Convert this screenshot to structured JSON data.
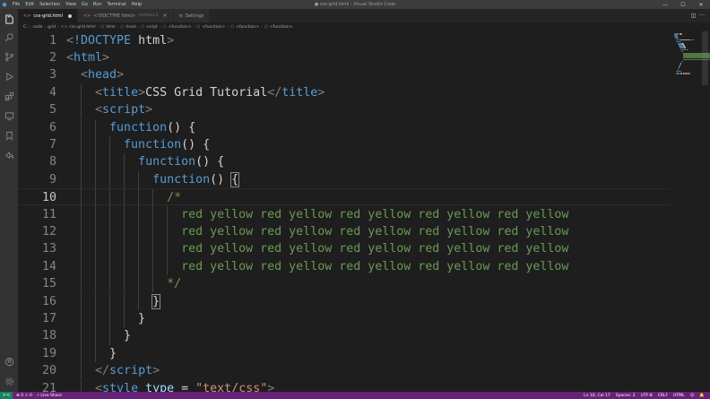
{
  "titlebar": {
    "menu": [
      "File",
      "Edit",
      "Selection",
      "View",
      "Go",
      "Run",
      "Terminal",
      "Help"
    ],
    "title": "● css-grid.html - Visual Studio Code"
  },
  "tabs": [
    {
      "label": "css-grid.html",
      "modified": true,
      "active": true
    },
    {
      "label": "<!DOCTYPE html>",
      "sub": "Untitled-1",
      "active": false
    },
    {
      "label": "Settings",
      "active": false
    }
  ],
  "breadcrumb": [
    "code",
    "grid",
    "css-grid.html",
    "html",
    "head",
    "script",
    "<function>",
    "<function>",
    "<function>",
    "<function>"
  ],
  "editor": {
    "current_line": 10,
    "lines": [
      {
        "n": "1",
        "tokens": [
          [
            "punc",
            "<"
          ],
          [
            "tag",
            "!DOCTYPE"
          ],
          [
            "text",
            " html"
          ],
          [
            "punc",
            ">"
          ]
        ]
      },
      {
        "n": "2",
        "tokens": [
          [
            "punc",
            "<"
          ],
          [
            "tag",
            "html"
          ],
          [
            "punc",
            ">"
          ]
        ]
      },
      {
        "n": "3",
        "tokens": [
          [
            "plain",
            "  "
          ],
          [
            "punc",
            "<"
          ],
          [
            "tag",
            "head"
          ],
          [
            "punc",
            ">"
          ]
        ]
      },
      {
        "n": "4",
        "tokens": [
          [
            "plain",
            "    "
          ],
          [
            "punc",
            "<"
          ],
          [
            "tag",
            "title"
          ],
          [
            "punc",
            ">"
          ],
          [
            "text",
            "CSS Grid Tutorial"
          ],
          [
            "punc",
            "</"
          ],
          [
            "tag",
            "title"
          ],
          [
            "punc",
            ">"
          ]
        ]
      },
      {
        "n": "5",
        "tokens": [
          [
            "plain",
            "    "
          ],
          [
            "punc",
            "<"
          ],
          [
            "tag",
            "script"
          ],
          [
            "punc",
            ">"
          ]
        ]
      },
      {
        "n": "6",
        "tokens": [
          [
            "plain",
            "      "
          ],
          [
            "kw",
            "function"
          ],
          [
            "plain",
            "() {"
          ]
        ]
      },
      {
        "n": "7",
        "tokens": [
          [
            "plain",
            "        "
          ],
          [
            "kw",
            "function"
          ],
          [
            "plain",
            "() {"
          ]
        ]
      },
      {
        "n": "8",
        "tokens": [
          [
            "plain",
            "          "
          ],
          [
            "kw",
            "function"
          ],
          [
            "plain",
            "() {"
          ]
        ]
      },
      {
        "n": "9",
        "tokens": [
          [
            "plain",
            "            "
          ],
          [
            "kw",
            "function"
          ],
          [
            "plain",
            "() "
          ],
          [
            "box",
            "{"
          ]
        ]
      },
      {
        "n": "10",
        "tokens": [
          [
            "plain",
            "              "
          ],
          [
            "cm",
            "/*"
          ]
        ]
      },
      {
        "n": "11",
        "tokens": [
          [
            "plain",
            "                "
          ],
          [
            "cm",
            "red yellow red yellow red yellow red yellow red yellow"
          ]
        ]
      },
      {
        "n": "12",
        "tokens": [
          [
            "plain",
            "                "
          ],
          [
            "cm",
            "red yellow red yellow red yellow red yellow red yellow"
          ]
        ]
      },
      {
        "n": "13",
        "tokens": [
          [
            "plain",
            "                "
          ],
          [
            "cm",
            "red yellow red yellow red yellow red yellow red yellow"
          ]
        ]
      },
      {
        "n": "14",
        "tokens": [
          [
            "plain",
            "                "
          ],
          [
            "cm",
            "red yellow red yellow red yellow red yellow red yellow"
          ]
        ]
      },
      {
        "n": "15",
        "tokens": [
          [
            "plain",
            "              "
          ],
          [
            "cm",
            "*/"
          ]
        ]
      },
      {
        "n": "16",
        "tokens": [
          [
            "plain",
            "            "
          ],
          [
            "box",
            "}"
          ]
        ]
      },
      {
        "n": "17",
        "tokens": [
          [
            "plain",
            "          }"
          ]
        ]
      },
      {
        "n": "18",
        "tokens": [
          [
            "plain",
            "        }"
          ]
        ]
      },
      {
        "n": "19",
        "tokens": [
          [
            "plain",
            "      }"
          ]
        ]
      },
      {
        "n": "20",
        "tokens": [
          [
            "plain",
            "    "
          ],
          [
            "punc",
            "</"
          ],
          [
            "tag",
            "script"
          ],
          [
            "punc",
            ">"
          ]
        ]
      },
      {
        "n": "21",
        "tokens": [
          [
            "plain",
            "    "
          ],
          [
            "punc",
            "<"
          ],
          [
            "tag",
            "style"
          ],
          [
            "plain",
            " "
          ],
          [
            "attr",
            "type"
          ],
          [
            "plain",
            " = "
          ],
          [
            "str",
            "\"text/css\""
          ],
          [
            "punc",
            ">"
          ]
        ]
      }
    ]
  },
  "statusbar": {
    "remote": "><",
    "left": [
      "⊗ 0  ⚠ 0",
      "⚡ Live Share"
    ],
    "right": [
      "Ln 10, Col 17",
      "Spaces: 2",
      "UTF-8",
      "CRLF",
      "HTML",
      "☺",
      "🔔"
    ]
  },
  "colors": {
    "statusbar": "#68217a",
    "remote": "#16825d",
    "keyword": "#569cd6",
    "comment": "#6a9955",
    "string": "#ce9178",
    "attribute": "#9cdcfe"
  }
}
